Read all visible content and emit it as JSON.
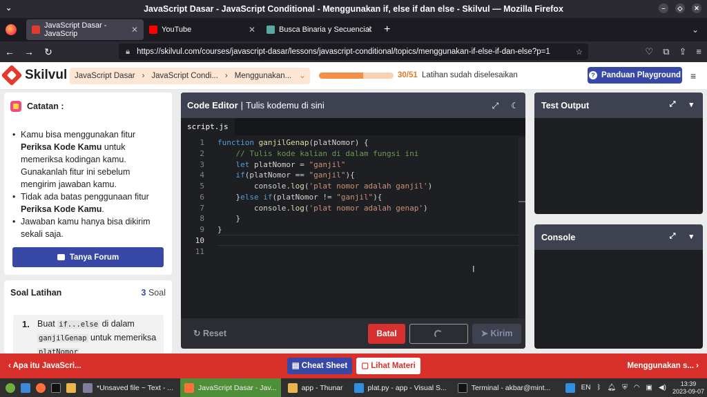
{
  "window": {
    "title": "JavaScript Dasar - JavaScript Conditional - Menggunakan if, else if dan else - Skilvul — Mozilla Firefox"
  },
  "browser": {
    "tabs": [
      {
        "label": "JavaScript Dasar - JavaScrip",
        "favicon_color": "#e23a2e"
      },
      {
        "label": "YouTube",
        "favicon_color": "#ff0000"
      },
      {
        "label": "Busca Binaria y Secuencial",
        "favicon_color": "#5aa9a0"
      }
    ],
    "url": "https://skilvul.com/courses/javascript-dasar/lessons/javascript-conditional/topics/menggunakan-if-else-if-dan-else?p=1"
  },
  "app": {
    "brand": "Skilvul",
    "breadcrumbs": [
      "JavaScript Dasar",
      "JavaScript Condi...",
      "Menggunakan..."
    ],
    "progress": {
      "done": 30,
      "total": 51,
      "label": "30/51",
      "text": "Latihan sudah diselesaikan"
    },
    "guide_button": "Panduan Playground"
  },
  "notes": {
    "title": "Catatan :",
    "items": [
      {
        "pre": "Kamu bisa menggunakan fitur ",
        "bold": "Periksa Kode Kamu",
        "post": " untuk memeriksa kodingan kamu. Gunakanlah fitur ini sebelum mengirim jawaban kamu."
      },
      {
        "pre": "Tidak ada batas penggunaan fitur ",
        "bold": "Periksa Kode Kamu",
        "post": "."
      },
      {
        "pre": "Jawaban kamu hanya bisa dikirim sekali saja.",
        "bold": "",
        "post": ""
      }
    ],
    "forum_button": "Tanya Forum"
  },
  "exercises": {
    "title": "Soal Latihan",
    "count": "3",
    "count_label": "Soal",
    "first": {
      "number": "1.",
      "t1": "Buat ",
      "c1": "if...else",
      "t2": " di dalam ",
      "c2": "ganjilGenap",
      "t3": " untuk memeriksa ",
      "c3": "platNomor"
    }
  },
  "editor": {
    "title": "Code Editor",
    "subtitle": "Tulis kodemu di sini",
    "file": "script.js",
    "line_numbers": [
      "1",
      "2",
      "3",
      "4",
      "5",
      "6",
      "7",
      "8",
      "9",
      "10",
      "11"
    ],
    "reset": "Reset",
    "cancel": "Batal",
    "submit": "Kirim",
    "code": {
      "l1a": "function",
      "l1b": " ",
      "l1c": "ganjilGenap",
      "l1d": "(platNomor) {",
      "l2": "    // Tulis kode kalian di dalam fungsi ini",
      "l3a": "    let",
      "l3b": " platNomor = ",
      "l3c": "\"ganjil\"",
      "l4a": "    if",
      "l4b": "(platNomor == ",
      "l4c": "\"ganjil\"",
      "l4d": "){",
      "l5a": "        console.",
      "l5b": "log",
      "l5c": "(",
      "l5d": "'plat nomor adalah ganjil'",
      "l5e": ")",
      "l6a": "    }",
      "l6b": "else if",
      "l6c": "(platNomor != ",
      "l6d": "\"ganjil\"",
      "l6e": "){",
      "l7a": "        console.",
      "l7b": "log",
      "l7c": "(",
      "l7d": "'plat nomor adalah genap'",
      "l7e": ")",
      "l8": "    }",
      "l9": "}"
    }
  },
  "panels": {
    "test_output": "Test Output",
    "console": "Console"
  },
  "footer": {
    "prev": "Apa itu JavaScri...",
    "next": "Menggunakan s...",
    "cheat_sheet": "Cheat Sheet",
    "lihat_materi": "Lihat Materi"
  },
  "taskbar": {
    "items": [
      {
        "label": "*Unsaved file ~ Text - ...",
        "icon": "text-editor-icon",
        "color": "#7e7e9e"
      },
      {
        "label": "JavaScript Dasar - Jav...",
        "icon": "firefox-icon",
        "color": "#ff7139"
      },
      {
        "label": "app - Thunar",
        "icon": "folder-icon",
        "color": "#e9b64a"
      },
      {
        "label": "plat.py - app - Visual S...",
        "icon": "vscode-icon",
        "color": "#2f8fe0"
      },
      {
        "label": "Terminal - akbar@mint...",
        "icon": "terminal-icon",
        "color": "#111111"
      }
    ],
    "lang": "EN",
    "time": "13:39",
    "date": "2023-09-07"
  }
}
